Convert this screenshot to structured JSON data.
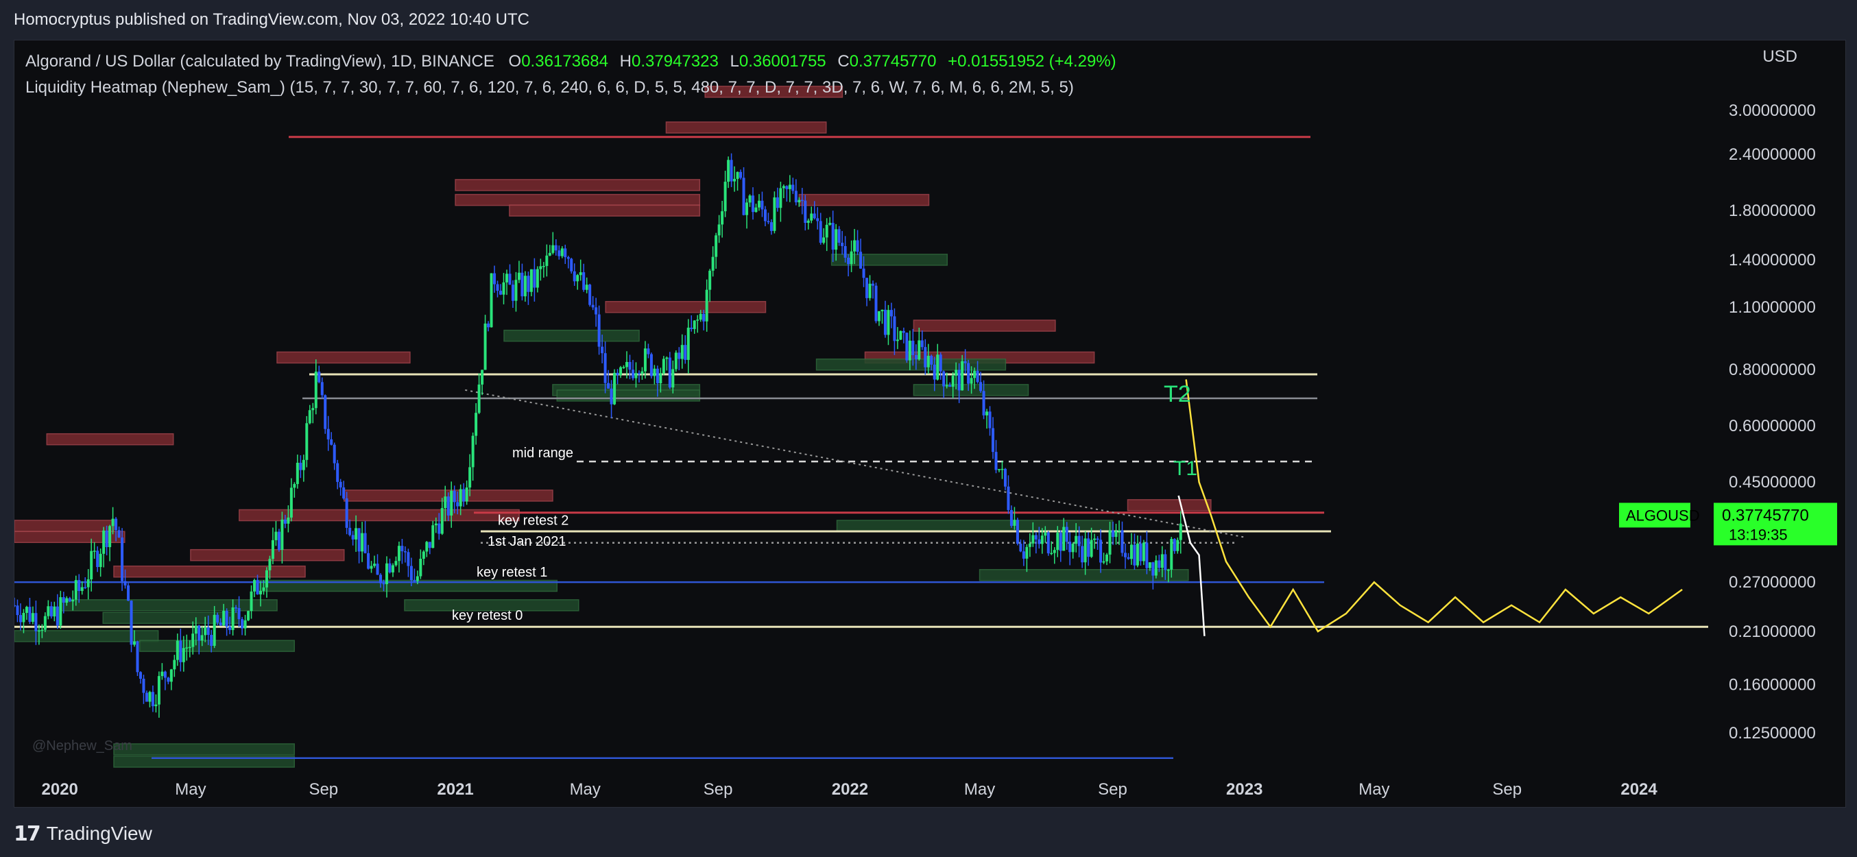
{
  "header": {
    "publisher_text": "Homocryptus published on TradingView.com, Nov 03, 2022 10:40 UTC"
  },
  "legend": {
    "symbol_text": "Algorand / US Dollar (calculated by TradingView), 1D, BINANCE",
    "o_label": "O",
    "o_value": "0.36173684",
    "h_label": "H",
    "h_value": "0.37947323",
    "l_label": "L",
    "l_value": "0.36001755",
    "c_label": "C",
    "c_value": "0.37745770",
    "change": "+0.01551952 (+4.29%)",
    "indicator_text": "Liquidity Heatmap (Nephew_Sam_) (15, 7, 7, 30, 7, 7, 60, 7, 6, 120, 7, 6, 240, 6, 6, D, 5, 5, 480, 7, 7, D, 7, 7, 3D, 7, 6, W, 7, 6, M, 6, 6, 2M, 5, 5)"
  },
  "price_axis": {
    "currency": "USD",
    "ticks": [
      "3.00000000",
      "2.40000000",
      "1.80000000",
      "1.40000000",
      "1.10000000",
      "0.80000000",
      "0.60000000",
      "0.45000000",
      "0.27000000",
      "0.21000000",
      "0.16000000",
      "0.12500000"
    ],
    "symbol_tag": "ALGOUSD",
    "last_price": "0.37745770",
    "countdown": "13:19:35"
  },
  "time_axis": {
    "labels": [
      "2020",
      "May",
      "Sep",
      "2021",
      "May",
      "Sep",
      "2022",
      "May",
      "Sep",
      "2023",
      "May",
      "Sep",
      "2024"
    ],
    "bold": [
      "2020",
      "2021",
      "2022",
      "2023",
      "2024"
    ]
  },
  "watermark": "@Nephew_Sam",
  "annotations": {
    "mid_range": "mid range",
    "key_retest_2": "key retest 2",
    "jan_2021": "1st Jan 2021",
    "key_retest_1": "key retest 1",
    "key_retest_0": "key retest 0",
    "t1": "T1",
    "t2": "T2"
  },
  "footer": {
    "brand": "TradingView"
  },
  "colors": {
    "candle_up": "#29e37a",
    "candle_down": "#2d5bff",
    "resistance_red": "#c73a47",
    "support_blue": "#2f55d4",
    "projection_yellow": "#ffe33d",
    "heat_red": "#7a2a2f",
    "heat_green": "#1f4a2a",
    "price_tag": "#29ff29"
  },
  "chart_data": {
    "type": "candlestick",
    "symbol": "ALGOUSD",
    "interval": "1D",
    "y_scale": "log",
    "ylim": [
      0.105,
      3.6
    ],
    "xlim": [
      "2019-11-20",
      "2024-02-15"
    ],
    "series": [
      {
        "name": "ALGOUSD",
        "x": [
          "2019-11-20",
          "2019-12-20",
          "2020-01-20",
          "2020-02-20",
          "2020-03-13",
          "2020-03-25",
          "2020-04-20",
          "2020-05-20",
          "2020-06-20",
          "2020-07-20",
          "2020-08-10",
          "2020-08-25",
          "2020-09-20",
          "2020-10-20",
          "2020-11-10",
          "2020-11-25",
          "2020-12-15",
          "2021-01-10",
          "2021-02-05",
          "2021-02-20",
          "2021-03-15",
          "2021-04-10",
          "2021-05-10",
          "2021-05-22",
          "2021-06-20",
          "2021-07-20",
          "2021-08-20",
          "2021-09-10",
          "2021-09-25",
          "2021-10-20",
          "2021-11-10",
          "2021-11-28",
          "2021-12-20",
          "2022-01-05",
          "2022-01-25",
          "2022-02-20",
          "2022-03-15",
          "2022-04-05",
          "2022-04-25",
          "2022-05-12",
          "2022-06-10",
          "2022-07-10",
          "2022-08-10",
          "2022-09-10",
          "2022-10-10",
          "2022-10-25",
          "2022-11-03"
        ],
        "close": [
          0.24,
          0.22,
          0.26,
          0.38,
          0.17,
          0.15,
          0.19,
          0.21,
          0.23,
          0.33,
          0.48,
          0.76,
          0.4,
          0.27,
          0.33,
          0.27,
          0.37,
          0.44,
          1.3,
          1.2,
          1.25,
          1.55,
          1.05,
          0.7,
          0.85,
          0.78,
          1.1,
          2.3,
          1.9,
          1.75,
          2.05,
          1.7,
          1.55,
          1.45,
          1.1,
          0.9,
          0.85,
          0.75,
          0.8,
          0.55,
          0.32,
          0.34,
          0.32,
          0.33,
          0.3,
          0.31,
          0.3775
        ]
      },
      {
        "name": "projection",
        "x": [
          "2022-11-08",
          "2022-11-20",
          "2022-12-01",
          "2022-12-15",
          "2023-01-05",
          "2023-01-25",
          "2023-02-15",
          "2023-03-10",
          "2023-04-05",
          "2023-05-01",
          "2023-05-25",
          "2023-06-20",
          "2023-07-15",
          "2023-08-10",
          "2023-09-05",
          "2023-10-01",
          "2023-10-25",
          "2023-11-20",
          "2023-12-15",
          "2024-01-10",
          "2024-02-10"
        ],
        "close": [
          0.76,
          0.45,
          0.38,
          0.3,
          0.25,
          0.215,
          0.26,
          0.21,
          0.23,
          0.27,
          0.24,
          0.22,
          0.25,
          0.22,
          0.24,
          0.22,
          0.26,
          0.23,
          0.25,
          0.23,
          0.26
        ]
      }
    ],
    "horizontal_levels": [
      {
        "price": 2.62,
        "color": "red"
      },
      {
        "price": 0.78,
        "color": "white"
      },
      {
        "price": 0.69,
        "color": "grey"
      },
      {
        "price": 0.5,
        "color": "white-dashed",
        "label": "mid range"
      },
      {
        "price": 0.385,
        "color": "red",
        "label": "key retest 2"
      },
      {
        "price": 0.35,
        "color": "white"
      },
      {
        "price": 0.33,
        "color": "white-dotted",
        "label": "1st Jan 2021"
      },
      {
        "price": 0.27,
        "color": "blue",
        "label": "key retest 1"
      },
      {
        "price": 0.215,
        "color": "white",
        "label": "key retest 0"
      },
      {
        "price": 0.11,
        "color": "blue"
      }
    ],
    "trendline": {
      "from": [
        "2021-01-10",
        0.72
      ],
      "to": [
        "2022-12-31",
        0.34
      ]
    },
    "heatmap_zones": [
      {
        "price": 3.3,
        "start": "2021-08-20",
        "end": "2021-12-25",
        "side": "sell"
      },
      {
        "price": 2.75,
        "start": "2021-07-15",
        "end": "2021-12-10",
        "side": "sell"
      },
      {
        "price": 2.05,
        "start": "2021-01-01",
        "end": "2021-08-15",
        "side": "sell"
      },
      {
        "price": 1.9,
        "start": "2021-01-01",
        "end": "2021-08-15",
        "side": "sell"
      },
      {
        "price": 1.8,
        "start": "2021-02-20",
        "end": "2021-08-15",
        "side": "sell"
      },
      {
        "price": 1.9,
        "start": "2021-11-15",
        "end": "2022-03-15",
        "side": "sell"
      },
      {
        "price": 1.1,
        "start": "2021-05-20",
        "end": "2021-10-15",
        "side": "sell"
      },
      {
        "price": 1.0,
        "start": "2022-03-01",
        "end": "2022-07-10",
        "side": "sell"
      },
      {
        "price": 0.85,
        "start": "2020-07-20",
        "end": "2020-11-20",
        "side": "sell"
      },
      {
        "price": 0.85,
        "start": "2022-01-15",
        "end": "2022-08-15",
        "side": "sell"
      },
      {
        "price": 0.56,
        "start": "2019-12-20",
        "end": "2020-04-15",
        "side": "sell"
      },
      {
        "price": 0.42,
        "start": "2020-09-20",
        "end": "2021-04-01",
        "side": "sell"
      },
      {
        "price": 0.4,
        "start": "2022-09-15",
        "end": "2022-12-01",
        "side": "sell"
      },
      {
        "price": 0.38,
        "start": "2020-06-15",
        "end": "2021-03-01",
        "side": "sell"
      },
      {
        "price": 0.36,
        "start": "2019-11-20",
        "end": "2020-02-20",
        "side": "sell"
      },
      {
        "price": 0.34,
        "start": "2019-11-20",
        "end": "2020-03-01",
        "side": "sell"
      },
      {
        "price": 0.31,
        "start": "2020-05-01",
        "end": "2020-09-20",
        "side": "sell"
      },
      {
        "price": 0.285,
        "start": "2020-02-20",
        "end": "2020-08-15",
        "side": "sell"
      },
      {
        "price": 1.4,
        "start": "2021-12-15",
        "end": "2022-04-01",
        "side": "buy"
      },
      {
        "price": 0.95,
        "start": "2021-02-15",
        "end": "2021-06-20",
        "side": "buy"
      },
      {
        "price": 0.82,
        "start": "2021-12-01",
        "end": "2022-05-25",
        "side": "buy"
      },
      {
        "price": 0.72,
        "start": "2021-04-01",
        "end": "2021-08-15",
        "side": "buy"
      },
      {
        "price": 0.7,
        "start": "2021-04-05",
        "end": "2021-08-15",
        "side": "buy"
      },
      {
        "price": 0.72,
        "start": "2022-03-01",
        "end": "2022-06-15",
        "side": "buy"
      },
      {
        "price": 0.36,
        "start": "2021-12-20",
        "end": "2022-09-01",
        "side": "buy"
      },
      {
        "price": 0.28,
        "start": "2022-05-01",
        "end": "2022-11-10",
        "side": "buy"
      },
      {
        "price": 0.265,
        "start": "2020-07-01",
        "end": "2021-04-05",
        "side": "buy"
      },
      {
        "price": 0.24,
        "start": "2020-01-01",
        "end": "2020-07-20",
        "side": "buy"
      },
      {
        "price": 0.24,
        "start": "2020-11-15",
        "end": "2021-04-25",
        "side": "buy"
      },
      {
        "price": 0.225,
        "start": "2020-02-10",
        "end": "2020-06-15",
        "side": "buy"
      },
      {
        "price": 0.205,
        "start": "2019-11-20",
        "end": "2020-04-01",
        "side": "buy"
      },
      {
        "price": 0.195,
        "start": "2020-03-15",
        "end": "2020-08-05",
        "side": "buy"
      },
      {
        "price": 0.115,
        "start": "2020-02-20",
        "end": "2020-08-05",
        "side": "buy"
      },
      {
        "price": 0.108,
        "start": "2020-02-20",
        "end": "2020-08-05",
        "side": "buy"
      }
    ]
  }
}
